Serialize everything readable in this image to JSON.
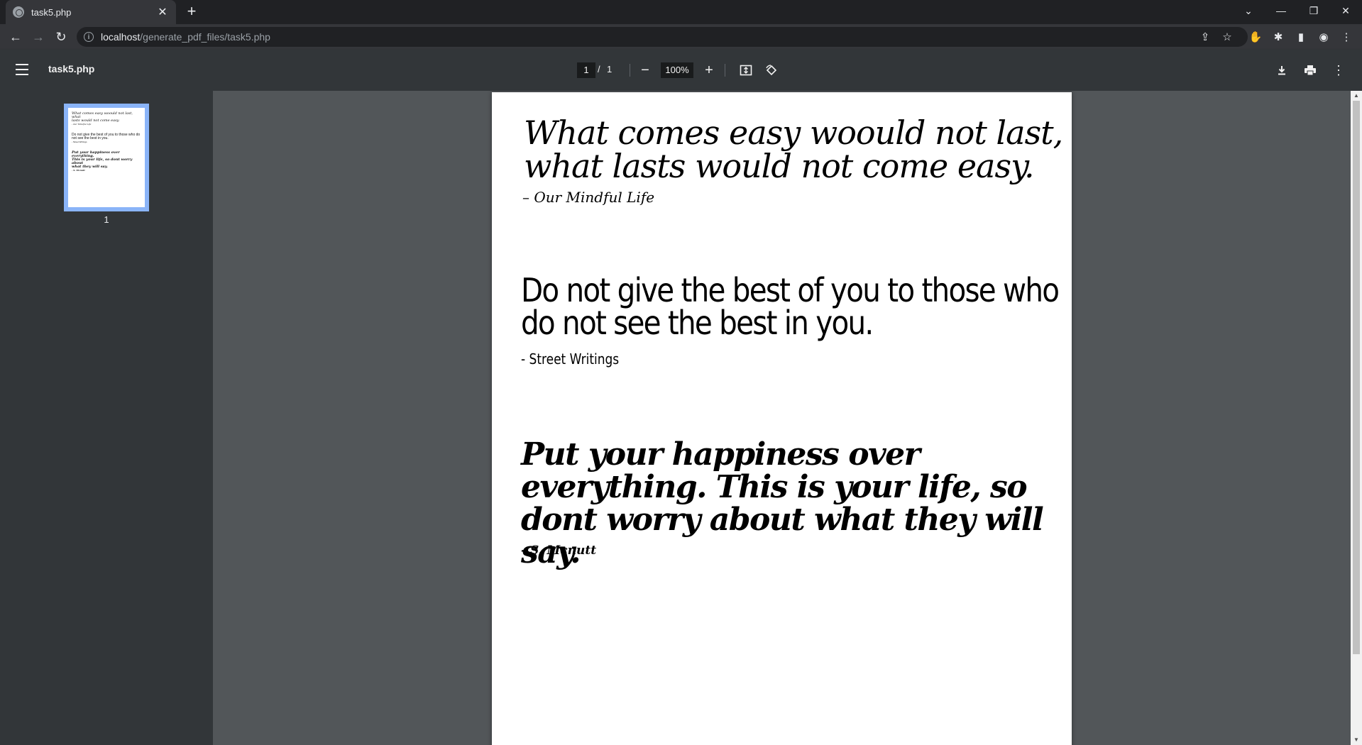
{
  "browser": {
    "tab_title": "task5.php",
    "url_host": "localhost",
    "url_path": "/generate_pdf_files/task5.php"
  },
  "pdf_toolbar": {
    "title": "task5.php",
    "current_page": "1",
    "page_separator": "/",
    "total_pages": "1",
    "zoom": "100%"
  },
  "sidebar": {
    "thumbnail_label": "1",
    "thumbnail_lines": [
      "What comes easy woould not last, what",
      "lasts would not come easy.",
      "- Our Mindful Life",
      "Do not give the best of you to those who do",
      "not see the best in you.",
      "- Street Writings",
      "Put your happiness over everything.",
      "This is your life, so dont worry about",
      "what they will say.",
      "- S. Mcnutt"
    ]
  },
  "document": {
    "quote1": "What comes easy woould not last, what lasts would not come easy.",
    "author1": "– Our Mindful Life",
    "quote2": "Do not give the best of you to those who do not see the best in you.",
    "author2": "- Street Writings",
    "quote3": "Put your happiness over everything. This is your life, so dont worry about what they will say.",
    "author3": "- S. Mcnutt"
  }
}
